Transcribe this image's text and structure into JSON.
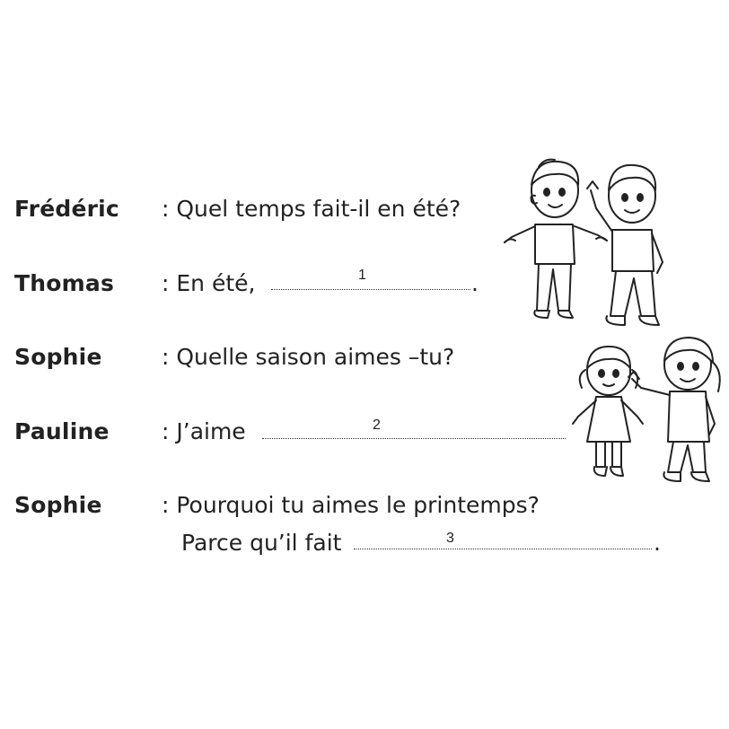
{
  "dialogue": [
    {
      "speaker": "Frédéric",
      "text": ": Quel temps fait-il en été?"
    },
    {
      "speaker": "Thomas",
      "text": ":  En été, ",
      "blank_number": "1",
      "end": "."
    },
    {
      "speaker": "Sophie",
      "text": ": Quelle saison aimes –tu?"
    },
    {
      "speaker": "Pauline",
      "text": ": J’aime ",
      "blank_number": "2"
    },
    {
      "speaker": "Sophie",
      "text": ": Pourquoi tu aimes le printemps?"
    }
  ],
  "continuation": {
    "text": "Parce qu’il fait",
    "blank_number": "3",
    "end": "."
  },
  "illustrations": [
    {
      "icon": "boys-illustration"
    },
    {
      "icon": "girls-illustration"
    }
  ]
}
